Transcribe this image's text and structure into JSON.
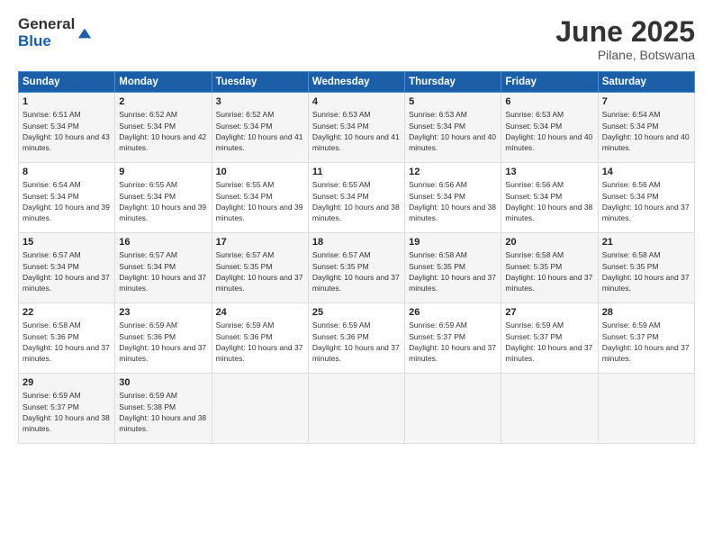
{
  "header": {
    "logo_general": "General",
    "logo_blue": "Blue",
    "title": "June 2025",
    "location": "Pilane, Botswana"
  },
  "weekdays": [
    "Sunday",
    "Monday",
    "Tuesday",
    "Wednesday",
    "Thursday",
    "Friday",
    "Saturday"
  ],
  "weeks": [
    [
      {
        "day": "1",
        "sunrise": "Sunrise: 6:51 AM",
        "sunset": "Sunset: 5:34 PM",
        "daylight": "Daylight: 10 hours and 43 minutes."
      },
      {
        "day": "2",
        "sunrise": "Sunrise: 6:52 AM",
        "sunset": "Sunset: 5:34 PM",
        "daylight": "Daylight: 10 hours and 42 minutes."
      },
      {
        "day": "3",
        "sunrise": "Sunrise: 6:52 AM",
        "sunset": "Sunset: 5:34 PM",
        "daylight": "Daylight: 10 hours and 41 minutes."
      },
      {
        "day": "4",
        "sunrise": "Sunrise: 6:53 AM",
        "sunset": "Sunset: 5:34 PM",
        "daylight": "Daylight: 10 hours and 41 minutes."
      },
      {
        "day": "5",
        "sunrise": "Sunrise: 6:53 AM",
        "sunset": "Sunset: 5:34 PM",
        "daylight": "Daylight: 10 hours and 40 minutes."
      },
      {
        "day": "6",
        "sunrise": "Sunrise: 6:53 AM",
        "sunset": "Sunset: 5:34 PM",
        "daylight": "Daylight: 10 hours and 40 minutes."
      },
      {
        "day": "7",
        "sunrise": "Sunrise: 6:54 AM",
        "sunset": "Sunset: 5:34 PM",
        "daylight": "Daylight: 10 hours and 40 minutes."
      }
    ],
    [
      {
        "day": "8",
        "sunrise": "Sunrise: 6:54 AM",
        "sunset": "Sunset: 5:34 PM",
        "daylight": "Daylight: 10 hours and 39 minutes."
      },
      {
        "day": "9",
        "sunrise": "Sunrise: 6:55 AM",
        "sunset": "Sunset: 5:34 PM",
        "daylight": "Daylight: 10 hours and 39 minutes."
      },
      {
        "day": "10",
        "sunrise": "Sunrise: 6:55 AM",
        "sunset": "Sunset: 5:34 PM",
        "daylight": "Daylight: 10 hours and 39 minutes."
      },
      {
        "day": "11",
        "sunrise": "Sunrise: 6:55 AM",
        "sunset": "Sunset: 5:34 PM",
        "daylight": "Daylight: 10 hours and 38 minutes."
      },
      {
        "day": "12",
        "sunrise": "Sunrise: 6:56 AM",
        "sunset": "Sunset: 5:34 PM",
        "daylight": "Daylight: 10 hours and 38 minutes."
      },
      {
        "day": "13",
        "sunrise": "Sunrise: 6:56 AM",
        "sunset": "Sunset: 5:34 PM",
        "daylight": "Daylight: 10 hours and 38 minutes."
      },
      {
        "day": "14",
        "sunrise": "Sunrise: 6:56 AM",
        "sunset": "Sunset: 5:34 PM",
        "daylight": "Daylight: 10 hours and 37 minutes."
      }
    ],
    [
      {
        "day": "15",
        "sunrise": "Sunrise: 6:57 AM",
        "sunset": "Sunset: 5:34 PM",
        "daylight": "Daylight: 10 hours and 37 minutes."
      },
      {
        "day": "16",
        "sunrise": "Sunrise: 6:57 AM",
        "sunset": "Sunset: 5:34 PM",
        "daylight": "Daylight: 10 hours and 37 minutes."
      },
      {
        "day": "17",
        "sunrise": "Sunrise: 6:57 AM",
        "sunset": "Sunset: 5:35 PM",
        "daylight": "Daylight: 10 hours and 37 minutes."
      },
      {
        "day": "18",
        "sunrise": "Sunrise: 6:57 AM",
        "sunset": "Sunset: 5:35 PM",
        "daylight": "Daylight: 10 hours and 37 minutes."
      },
      {
        "day": "19",
        "sunrise": "Sunrise: 6:58 AM",
        "sunset": "Sunset: 5:35 PM",
        "daylight": "Daylight: 10 hours and 37 minutes."
      },
      {
        "day": "20",
        "sunrise": "Sunrise: 6:58 AM",
        "sunset": "Sunset: 5:35 PM",
        "daylight": "Daylight: 10 hours and 37 minutes."
      },
      {
        "day": "21",
        "sunrise": "Sunrise: 6:58 AM",
        "sunset": "Sunset: 5:35 PM",
        "daylight": "Daylight: 10 hours and 37 minutes."
      }
    ],
    [
      {
        "day": "22",
        "sunrise": "Sunrise: 6:58 AM",
        "sunset": "Sunset: 5:36 PM",
        "daylight": "Daylight: 10 hours and 37 minutes."
      },
      {
        "day": "23",
        "sunrise": "Sunrise: 6:59 AM",
        "sunset": "Sunset: 5:36 PM",
        "daylight": "Daylight: 10 hours and 37 minutes."
      },
      {
        "day": "24",
        "sunrise": "Sunrise: 6:59 AM",
        "sunset": "Sunset: 5:36 PM",
        "daylight": "Daylight: 10 hours and 37 minutes."
      },
      {
        "day": "25",
        "sunrise": "Sunrise: 6:59 AM",
        "sunset": "Sunset: 5:36 PM",
        "daylight": "Daylight: 10 hours and 37 minutes."
      },
      {
        "day": "26",
        "sunrise": "Sunrise: 6:59 AM",
        "sunset": "Sunset: 5:37 PM",
        "daylight": "Daylight: 10 hours and 37 minutes."
      },
      {
        "day": "27",
        "sunrise": "Sunrise: 6:59 AM",
        "sunset": "Sunset: 5:37 PM",
        "daylight": "Daylight: 10 hours and 37 minutes."
      },
      {
        "day": "28",
        "sunrise": "Sunrise: 6:59 AM",
        "sunset": "Sunset: 5:37 PM",
        "daylight": "Daylight: 10 hours and 37 minutes."
      }
    ],
    [
      {
        "day": "29",
        "sunrise": "Sunrise: 6:59 AM",
        "sunset": "Sunset: 5:37 PM",
        "daylight": "Daylight: 10 hours and 38 minutes."
      },
      {
        "day": "30",
        "sunrise": "Sunrise: 6:59 AM",
        "sunset": "Sunset: 5:38 PM",
        "daylight": "Daylight: 10 hours and 38 minutes."
      },
      null,
      null,
      null,
      null,
      null
    ]
  ]
}
